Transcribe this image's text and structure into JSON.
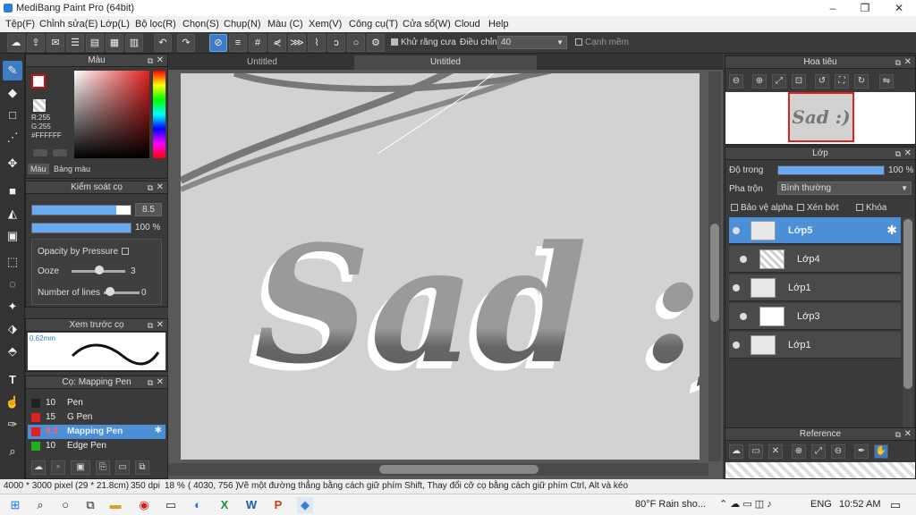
{
  "window": {
    "title": "MediBang Paint Pro (64bit)"
  },
  "menu": [
    "Tệp(F)",
    "Chỉnh sửa(E)",
    "Lớp(L)",
    "Bộ lọc(R)",
    "Chọn(S)",
    "Chụp(N)",
    "Màu (C)",
    "Xem(V)",
    "Công cụ(T)",
    "Cửa sổ(W)",
    "Cloud",
    "Help"
  ],
  "toolbar": {
    "antialias_label": "Khử răng cưa",
    "correction_label": "Điều chỉnh",
    "correction_value": "40",
    "smooth_label": "Cạnh mềm"
  },
  "color_panel": {
    "title": "Màu",
    "r": "R:255",
    "g": "G:255",
    "hex": "#FFFFFF",
    "tab_color": "Màu",
    "tab_palette": "Bảng màu"
  },
  "brush_control": {
    "title": "Kiểm soát cọ",
    "size": "8.5",
    "opacity": "100 %",
    "opacity_fill": 1.0,
    "size_fill": 0.85,
    "opacity_pressure_label": "Opacity by Pressure",
    "ooze_label": "Ooze",
    "ooze_value": "3",
    "lines_label": "Number of lines",
    "lines_value": "0"
  },
  "brush_preview": {
    "title": "Xem trước cọ",
    "size": "0.62mm"
  },
  "brush_list": {
    "title": "Cọ: Mapping Pen",
    "items": [
      {
        "size": "10",
        "name": "Pen",
        "color": "#222222"
      },
      {
        "size": "15",
        "name": "G Pen",
        "color": "#e02020"
      },
      {
        "size": "8.5",
        "name": "Mapping Pen",
        "color": "#e02020"
      },
      {
        "size": "10",
        "name": "Edge Pen",
        "color": "#20b020"
      }
    ]
  },
  "canvas": {
    "tabs": [
      "Untitled",
      "Untitled"
    ],
    "artwork_text": "Sad :)"
  },
  "navigator": {
    "title": "Hoa tiêu"
  },
  "layers": {
    "title": "Lớp",
    "opacity_label": "Độ trong",
    "opacity_value": "100 %",
    "blend_label": "Pha trộn",
    "blend_value": "Bình thường",
    "protect_alpha": "Bảo vệ alpha",
    "clipping": "Xén bớt",
    "lock": "Khóa",
    "items": [
      {
        "name": "Lớp5"
      },
      {
        "name": "Lớp4"
      },
      {
        "name": "Lớp1"
      },
      {
        "name": "Lớp3"
      },
      {
        "name": "Lớp1"
      }
    ]
  },
  "reference": {
    "title": "Reference"
  },
  "status": {
    "size": "4000 * 3000 pixel",
    "physical": "(29 * 21.8cm)",
    "dpi": "350 dpi",
    "zoom": "18 %",
    "coords": "( 4030, 756 )",
    "hint": "Vẽ một đường thẳng bằng cách giữ phím Shift, Thay đổi cỡ cọ bằng cách giữ phím Ctrl, Alt và kéo"
  },
  "taskbar": {
    "weather": "80°F  Rain sho...",
    "lang": "ENG",
    "time": "10:52 AM"
  }
}
